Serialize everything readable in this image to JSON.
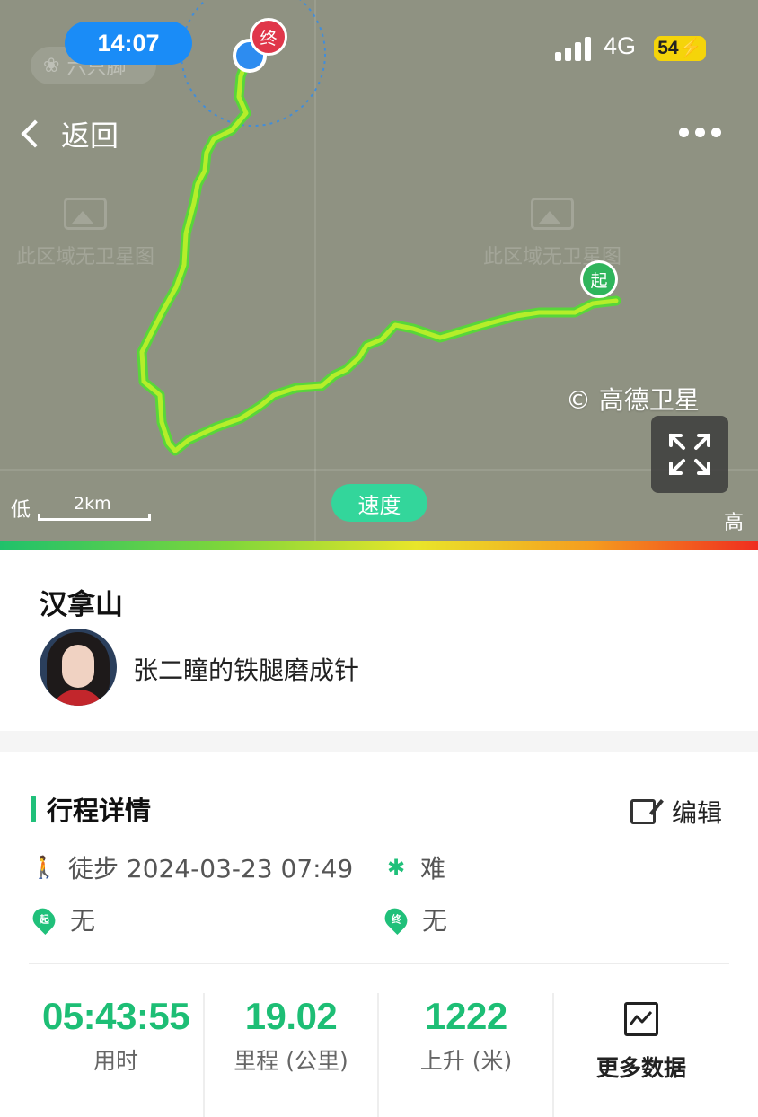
{
  "status_bar": {
    "time": "14:07",
    "app_chip": "六只脚",
    "network": "4G",
    "battery": "54"
  },
  "nav": {
    "back_label": "返回"
  },
  "map": {
    "no_satellite_text": "此区域无卫星图",
    "start_marker": "起",
    "end_marker": "终",
    "copyright": "© 高德卫星",
    "scale_label": "2km",
    "legend_low": "低",
    "legend_high": "高",
    "mode_button": "速度",
    "colors": {
      "route": "#9be22d",
      "route_edge": "#58d63a",
      "start": "#2fb55c",
      "end": "#e0364a",
      "current": "#2d8cf0"
    }
  },
  "route": {
    "title": "汉拿山",
    "author": "张二瞳的铁腿磨成针"
  },
  "details": {
    "section_title": "行程详情",
    "edit_label": "编辑",
    "activity": "徒步 2024-03-23 07:49",
    "difficulty": "难",
    "start_point": "无",
    "end_point": "无",
    "start_icon_char": "起",
    "end_icon_char": "终"
  },
  "stats": [
    {
      "value": "05:43:55",
      "label": "用时"
    },
    {
      "value": "19.02",
      "label": "里程 (公里)"
    },
    {
      "value": "1222",
      "label": "上升 (米)"
    }
  ],
  "more_data_label": "更多数据"
}
